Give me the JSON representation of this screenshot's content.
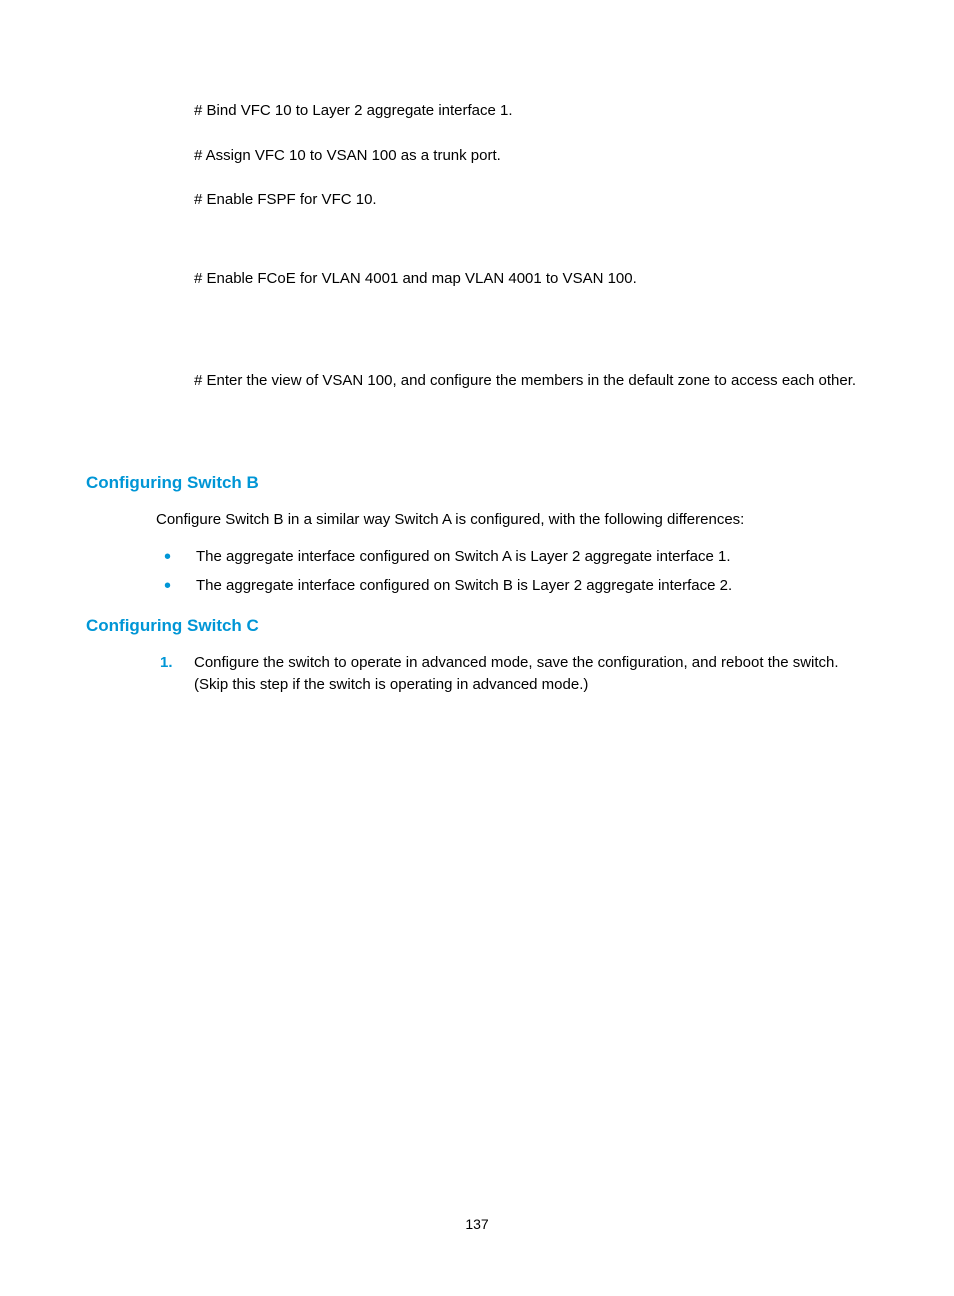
{
  "paragraphs": {
    "p1": "# Bind VFC 10 to Layer 2 aggregate interface 1.",
    "p2": "# Assign VFC 10 to VSAN 100 as a trunk port.",
    "p3": "# Enable FSPF for VFC 10.",
    "p4": "# Enable FCoE for VLAN 4001 and map VLAN 4001 to VSAN 100.",
    "p5": "# Enter the view of VSAN 100, and configure the members in the default zone to access each other."
  },
  "sectionB": {
    "heading": "Configuring Switch B",
    "intro": "Configure Switch B in a similar way Switch A is configured, with the following differences:",
    "bullets": [
      "The aggregate interface configured on Switch A is Layer 2 aggregate interface 1.",
      "The aggregate interface configured on Switch B is Layer 2 aggregate interface 2."
    ]
  },
  "sectionC": {
    "heading": "Configuring Switch C",
    "items": [
      {
        "num": "1.",
        "text": "Configure the switch to operate in advanced mode, save the configuration, and reboot the switch. (Skip this step if the switch is operating in advanced mode.)"
      }
    ]
  },
  "pageNumber": "137"
}
